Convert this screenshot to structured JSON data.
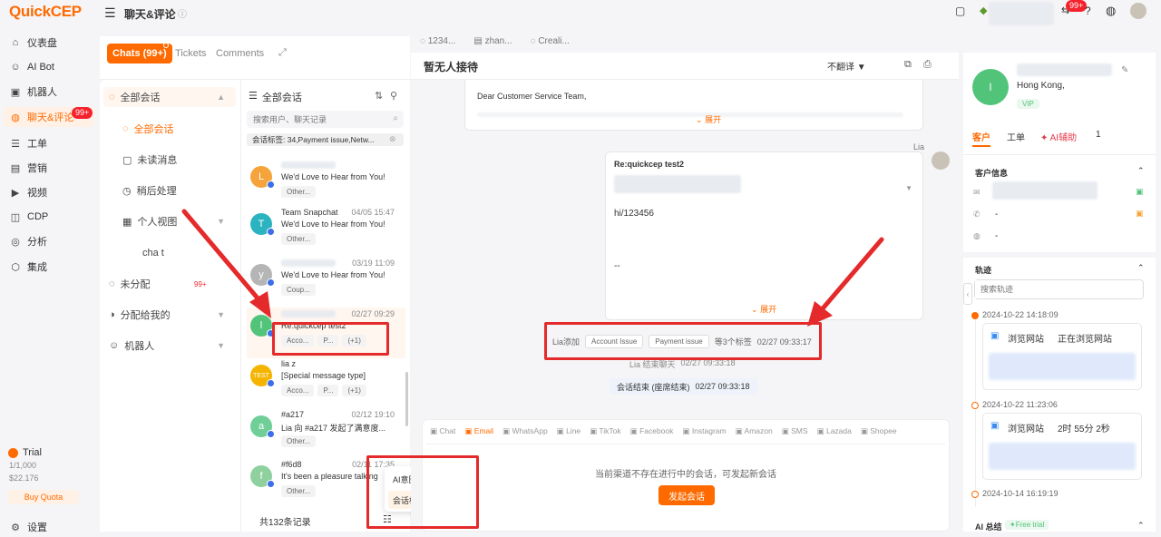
{
  "brand": {
    "logo": "QuickCEP"
  },
  "nav": {
    "items": [
      {
        "label": "仪表盘",
        "icon": "dashboard-icon"
      },
      {
        "label": "AI Bot",
        "icon": "bot-icon"
      },
      {
        "label": "机器人",
        "icon": "robot-icon"
      },
      {
        "label": "聊天&评论",
        "icon": "chat-icon",
        "badge": "99+"
      },
      {
        "label": "工单",
        "icon": "ticket-icon"
      },
      {
        "label": "营销",
        "icon": "marketing-icon"
      },
      {
        "label": "视频",
        "icon": "video-icon"
      },
      {
        "label": "CDP",
        "icon": "cdp-icon"
      },
      {
        "label": "分析",
        "icon": "analytics-icon"
      },
      {
        "label": "集成",
        "icon": "integration-icon"
      }
    ],
    "trial": {
      "label": "Trial",
      "usage": "1/1,000",
      "amount": "$22.176",
      "buy": "Buy Quota"
    },
    "settings": "设置"
  },
  "header": {
    "title": "聊天&评论",
    "notif_badge": "99+"
  },
  "tabs": {
    "chats": "Chats (99+)",
    "tickets": "Tickets",
    "comments": "Comments"
  },
  "left_menu": {
    "all_sessions": "全部会话",
    "sub_all": "全部会话",
    "unread": "未读消息",
    "later": "稍后处理",
    "personal_view": "个人视图",
    "chat": "cha t",
    "unassigned": "未分配",
    "unassigned_badge": "99+",
    "assigned_to_me": "分配给我的",
    "bot": "机器人"
  },
  "conv_list": {
    "title": "全部会话",
    "search_placeholder": "搜索用户、聊天记录",
    "filter": "会话标签: 34,Payment issue,Netw...",
    "footer": "共132条记录",
    "items": [
      {
        "avatar": "L",
        "color": "#f5a33b",
        "name": "",
        "time": "",
        "msg": "We'd Love to Hear from You!",
        "tags": [
          "Other..."
        ]
      },
      {
        "avatar": "T",
        "color": "#2bb3c0",
        "name": "Team Snapchat",
        "time": "04/05 15:47",
        "msg": "We'd Love to Hear from You!",
        "tags": [
          "Other..."
        ]
      },
      {
        "avatar": "y",
        "color": "#b5b5b5",
        "name": "",
        "time": "03/19 11:09",
        "msg": "We'd Love to Hear from You!",
        "tags": [
          "Coup..."
        ]
      },
      {
        "avatar": "l",
        "color": "#52c47a",
        "name": "",
        "time": "02/27 09:29",
        "msg": "Re:quickcep test2",
        "tags": [
          "Acco...",
          "P...",
          "(+1)"
        ]
      },
      {
        "avatar": "TEST",
        "color": "#f5b400",
        "name": "lia z",
        "time": "",
        "msg": "[Special message type]",
        "tags": [
          "Acco...",
          "P...",
          "(+1)"
        ]
      },
      {
        "avatar": "a",
        "color": "#6fcf97",
        "name": "#a217",
        "time": "02/12 19:10",
        "msg": "Lia 向 #a217 发起了满意度...",
        "tags": [
          "Other..."
        ]
      },
      {
        "avatar": "f",
        "color": "#8fd19e",
        "name": "#f6d8",
        "time": "02/11 17:35",
        "msg": "It's been a pleasure talking",
        "tags": [
          "Other..."
        ]
      }
    ]
  },
  "popup": {
    "ai_tag": "AI意图标签",
    "session_tag": "会话标签"
  },
  "top_tabs": [
    "1234...",
    "zhan...",
    "Creali..."
  ],
  "chat": {
    "title": "暂无人接待",
    "translate": "不翻译",
    "email1_greeting": "Dear Customer Service Team,",
    "expand": "展开",
    "agent": "Lia",
    "email2_subject": "Re:quickcep test2",
    "email2_body": "hi/123456",
    "email2_sig": "--",
    "tag_event_prefix": "Lia添加",
    "tag_event_tags": [
      "Account Issue",
      "Payment issue"
    ],
    "tag_event_suffix": "等3个标签",
    "tag_event_time": "02/27 09:33:17",
    "end_chat_event": "Lia 结束聊天",
    "end_chat_time": "02/27 09:33:18",
    "session_end": "会话结束 (座席结束)",
    "session_end_time": "02/27 09:33:18",
    "channels": [
      "Chat",
      "Email",
      "WhatsApp",
      "Line",
      "TikTok",
      "Facebook",
      "Instagram",
      "Amazon",
      "SMS",
      "Lazada",
      "Shopee"
    ],
    "no_session": "当前渠道不存在进行中的会话，可发起新会话",
    "start_btn": "发起会话"
  },
  "customer": {
    "avatar": "l",
    "location": "Hong Kong,",
    "vip": "VIP",
    "tabs": [
      "客户",
      "工单",
      "AI辅助",
      "1"
    ],
    "info_title": "客户信息",
    "phone": "-",
    "whatsapp": "-",
    "track_title": "轨迹",
    "track_search": "搜索轨迹",
    "tracks": [
      {
        "time": "2024-10-22 14:18:09",
        "label": "浏览网站",
        "detail": "正在浏览网站"
      },
      {
        "time": "2024-10-22 11:23:06",
        "label": "浏览网站",
        "detail": "2时 55分 2秒"
      },
      {
        "time": "2024-10-14 16:19:19",
        "label": "",
        "detail": ""
      }
    ],
    "ai_summary": "AI 总结",
    "free_trial": "Free trial"
  }
}
